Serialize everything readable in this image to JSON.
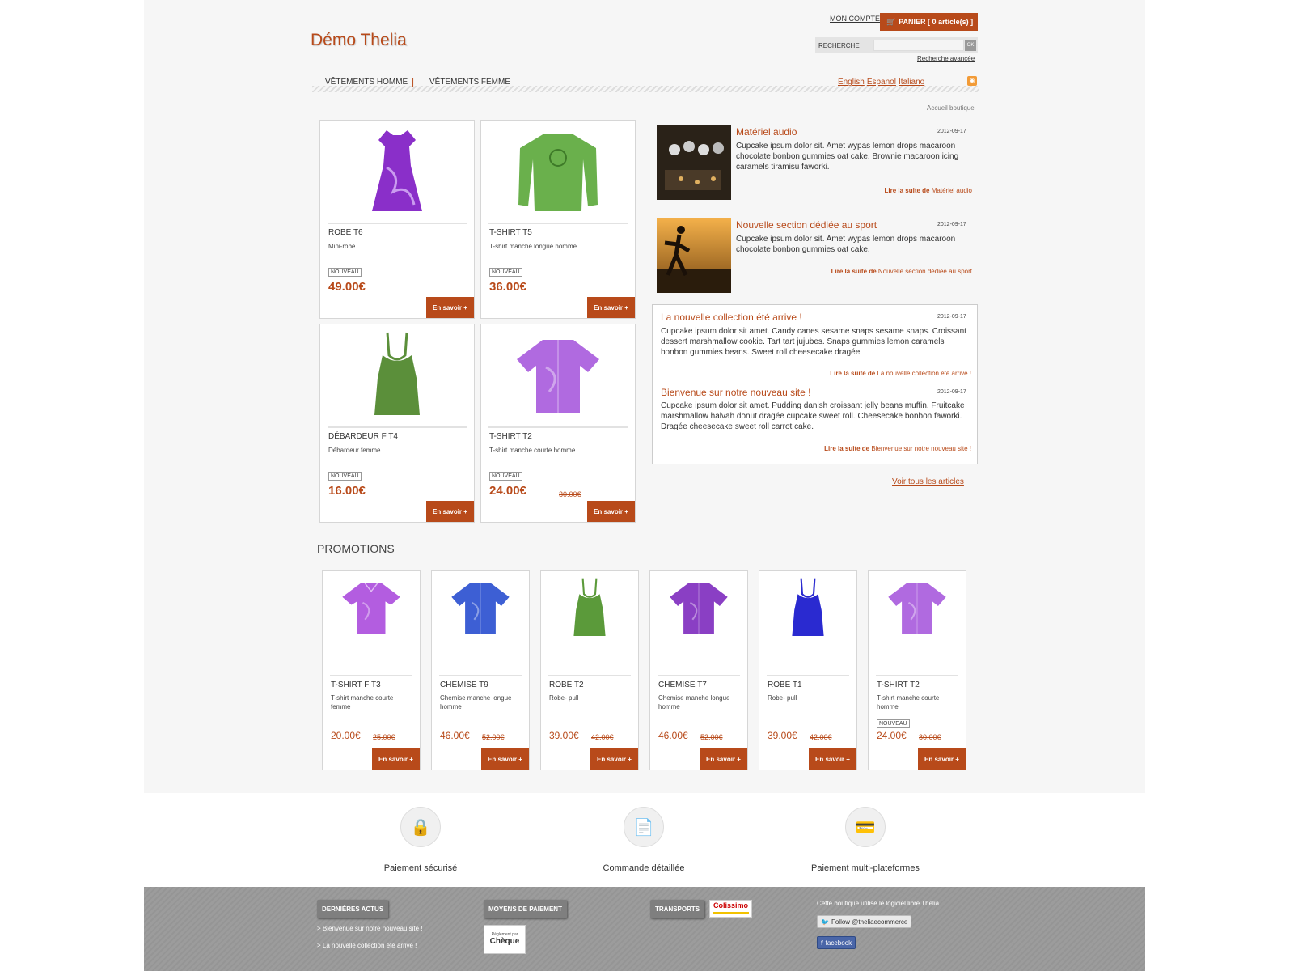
{
  "header": {
    "logo": "Démo Thelia",
    "account": "MON COMPTE",
    "cart": "PANIER [ 0 article(s) ]",
    "search_label": "RECHERCHE",
    "search_btn": "OK",
    "advanced": "Recherche avancée"
  },
  "nav": {
    "categories": [
      "VÊTEMENTS HOMME",
      "VÊTEMENTS FEMME"
    ],
    "languages": [
      "English",
      "Espanol",
      "Italiano"
    ]
  },
  "breadcrumb": "Accueil boutique",
  "featured": [
    {
      "name": "ROBE T6",
      "desc": "Mini-robe",
      "badge": "NOUVEAU",
      "price": "49.00€",
      "old": "",
      "more": "En savoir +",
      "color": "#8a2fc9"
    },
    {
      "name": "T-SHIRT T5",
      "desc": "T-shirt manche longue homme",
      "badge": "NOUVEAU",
      "price": "36.00€",
      "old": "",
      "more": "En savoir +",
      "color": "#6ab04c"
    },
    {
      "name": "DÉBARDEUR F T4",
      "desc": "Débardeur femme",
      "badge": "NOUVEAU",
      "price": "16.00€",
      "old": "",
      "more": "En savoir +",
      "color": "#5b8f3a"
    },
    {
      "name": "T-SHIRT T2",
      "desc": "T-shirt manche courte homme",
      "badge": "NOUVEAU",
      "price": "24.00€",
      "old": "30.00€",
      "more": "En savoir +",
      "color": "#b06ae0"
    }
  ],
  "news": [
    {
      "title": "Matériel audio",
      "date": "2012-09-17",
      "text": "Cupcake ipsum dolor sit. Amet wypas lemon drops macaroon chocolate bonbon gummies oat cake. Brownie macaroon icing caramels tiramisu faworki.",
      "link_prefix": "Lire la suite de",
      "link": "Matériel audio"
    },
    {
      "title": "Nouvelle section dédiée au sport",
      "date": "2012-09-17",
      "text": "Cupcake ipsum dolor sit. Amet wypas lemon drops macaroon chocolate bonbon gummies oat cake.",
      "link_prefix": "Lire la suite de",
      "link": "Nouvelle section dédiée au sport"
    },
    {
      "title": "La nouvelle collection été arrive !",
      "date": "2012-09-17",
      "text": "Cupcake ipsum dolor sit amet. Candy canes sesame snaps sesame snaps. Croissant dessert marshmallow cookie. Tart tart jujubes. Snaps gummies lemon caramels bonbon gummies beans. Sweet roll cheesecake dragée",
      "link_prefix": "Lire la suite de",
      "link": "La nouvelle collection été arrive !"
    },
    {
      "title": "Bienvenue sur notre nouveau site !",
      "date": "2012-09-17",
      "text": "Cupcake ipsum dolor sit amet. Pudding danish croissant jelly beans muffin. Fruitcake marshmallow halvah donut dragée cupcake sweet roll. Cheesecake bonbon faworki. Dragée cheesecake sweet roll carrot cake.",
      "link_prefix": "Lire la suite de",
      "link": "Bienvenue sur notre nouveau site !"
    }
  ],
  "all_articles": "Voir tous les articles",
  "promotions_title": "PROMOTIONS",
  "promotions": [
    {
      "name": "T-SHIRT F T3",
      "desc": "T-shirt manche courte femme",
      "badge": "",
      "price": "20.00€",
      "old": "25.00€",
      "more": "En savoir +",
      "color": "#b35de0"
    },
    {
      "name": "CHEMISE T9",
      "desc": "Chemise manche longue homme",
      "badge": "",
      "price": "46.00€",
      "old": "52.00€",
      "more": "En savoir +",
      "color": "#3d5fd4"
    },
    {
      "name": "ROBE T2",
      "desc": "Robe- pull",
      "badge": "",
      "price": "39.00€",
      "old": "42.00€",
      "more": "En savoir +",
      "color": "#5b9a3a"
    },
    {
      "name": "CHEMISE T7",
      "desc": "Chemise manche longue homme",
      "badge": "",
      "price": "46.00€",
      "old": "52.00€",
      "more": "En savoir +",
      "color": "#8a3fc4"
    },
    {
      "name": "ROBE T1",
      "desc": "Robe- pull",
      "badge": "",
      "price": "39.00€",
      "old": "42.00€",
      "more": "En savoir +",
      "color": "#2a2ad0"
    },
    {
      "name": "T-SHIRT T2",
      "desc": "T-shirt manche courte homme",
      "badge": "NOUVEAU",
      "price": "24.00€",
      "old": "30.00€",
      "more": "En savoir +",
      "color": "#b06ae0"
    }
  ],
  "features": [
    "Paiement sécurisé",
    "Commande détaillée",
    "Paiement multi-plateformes"
  ],
  "footer": {
    "news_tab": "DERNIÈRES ACTUS",
    "news_links": [
      "> Bienvenue sur notre nouveau site !",
      "> La nouvelle collection été arrive !"
    ],
    "payment_tab": "MOYENS DE PAIEMENT",
    "cheque_small": "Règlement par",
    "cheque": "Chèque",
    "transport_tab": "TRANSPORTS",
    "colissimo": "Colissimo",
    "credit": "Cette boutique utilise le logiciel libre Thelia",
    "twitter": "Follow @theliaecommerce",
    "facebook": "facebook"
  }
}
